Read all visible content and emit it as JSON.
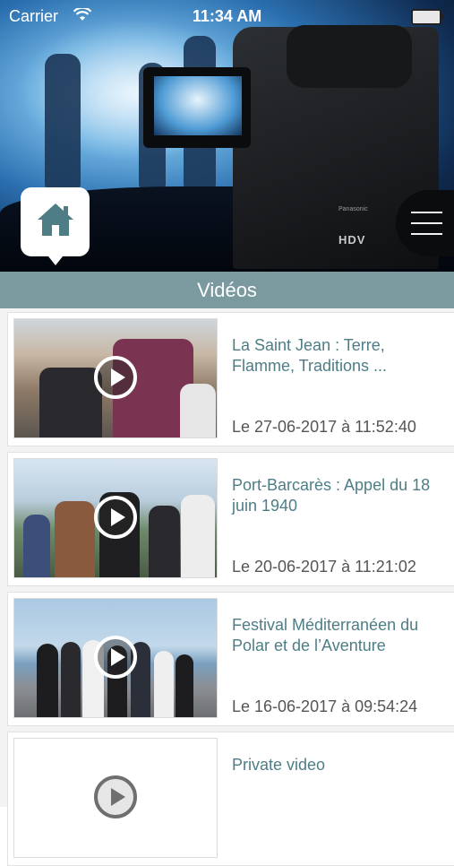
{
  "status_bar": {
    "carrier": "Carrier",
    "time": "11:34 AM"
  },
  "hero": {
    "camera_label": "HDV",
    "camera_brand": "Panasonic"
  },
  "nav": {
    "home_icon": "home-icon",
    "menu_icon": "hamburger-menu-icon"
  },
  "section": {
    "title": "Vidéos",
    "color": "#7a9aa0"
  },
  "videos": [
    {
      "title": "La Saint Jean : Terre, Flamme, Traditions ...",
      "date": "Le 27-06-2017 à 11:52:40"
    },
    {
      "title": "Port-Barcarès : Appel du 18 juin 1940",
      "date": "Le 20-06-2017 à 11:21:02"
    },
    {
      "title": "Festival Méditerranéen du Polar et de l’Aventure",
      "date": "Le 16-06-2017 à 09:54:24"
    },
    {
      "title": "Private video",
      "date": ""
    }
  ],
  "colors": {
    "title_text": "#4e7d86",
    "date_text": "#555555"
  }
}
